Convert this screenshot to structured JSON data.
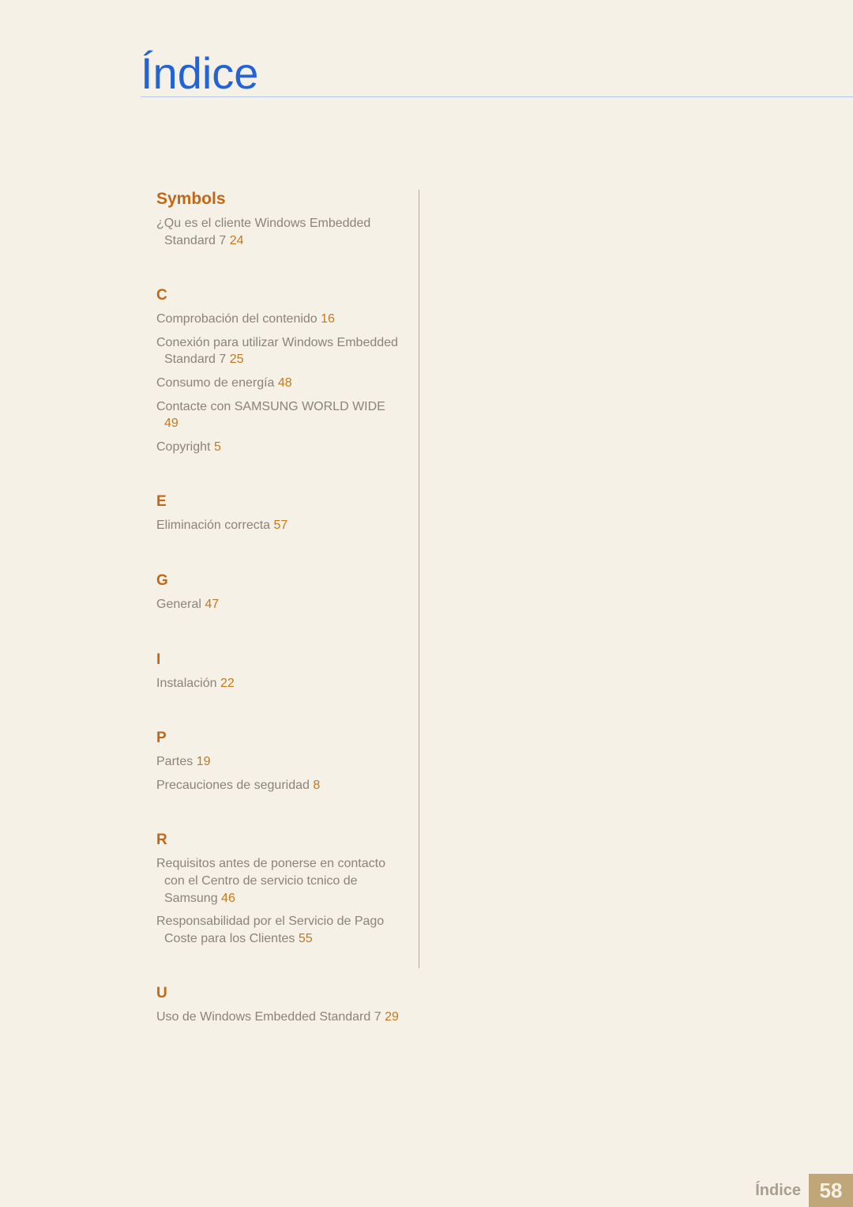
{
  "page": {
    "title": "Índice",
    "footer_label": "Índice",
    "footer_page": "58"
  },
  "sections": [
    {
      "heading": "Symbols",
      "first": true,
      "entries": [
        {
          "text": "¿Qu es el cliente Windows Embedded Standard 7",
          "page": "24"
        }
      ]
    },
    {
      "heading": "C",
      "entries": [
        {
          "text": "Comprobación del contenido",
          "page": "16"
        },
        {
          "text": "Conexión para utilizar Windows Embedded Standard 7",
          "page": "25"
        },
        {
          "text": "Consumo de energía",
          "page": "48"
        },
        {
          "text": "Contacte con SAMSUNG WORLD WIDE",
          "page": "49"
        },
        {
          "text": "Copyright",
          "page": "5"
        }
      ]
    },
    {
      "heading": "E",
      "entries": [
        {
          "text": "Eliminación correcta",
          "page": "57"
        }
      ]
    },
    {
      "heading": "G",
      "entries": [
        {
          "text": "General",
          "page": "47"
        }
      ]
    },
    {
      "heading": "I",
      "entries": [
        {
          "text": "Instalación",
          "page": "22"
        }
      ]
    },
    {
      "heading": "P",
      "entries": [
        {
          "text": "Partes",
          "page": "19"
        },
        {
          "text": "Precauciones de seguridad",
          "page": "8"
        }
      ]
    },
    {
      "heading": "R",
      "entries": [
        {
          "text": "Requisitos antes de ponerse en contacto con el Centro de servicio tcnico de Samsung",
          "page": "46"
        },
        {
          "text": "Responsabilidad por el Servicio de Pago Coste para los Clientes",
          "page": "55"
        }
      ]
    },
    {
      "heading": "U",
      "entries": [
        {
          "text": "Uso de Windows Embedded Standard 7",
          "page": "29"
        }
      ]
    }
  ]
}
